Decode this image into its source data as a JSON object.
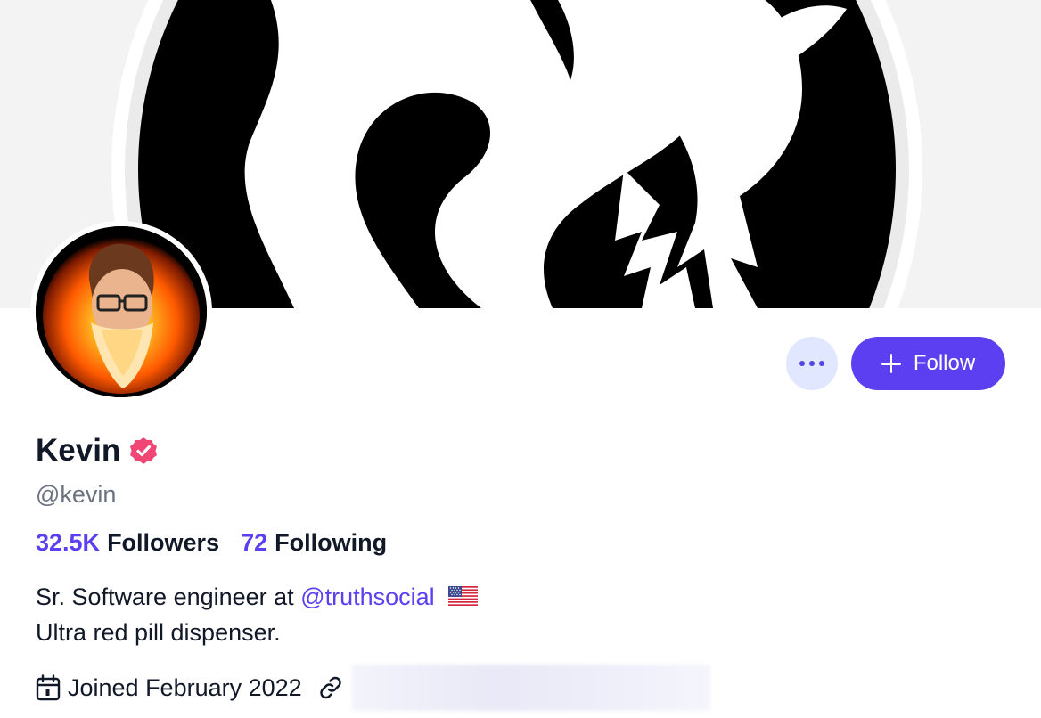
{
  "profile": {
    "display_name": "Kevin",
    "handle": "@kevin",
    "verified": true,
    "verified_color": "#ef4675",
    "accent_color": "#5b3ff0"
  },
  "actions": {
    "more_icon": "ellipsis-icon",
    "follow_label": "Follow",
    "follow_icon": "plus-icon"
  },
  "stats": {
    "followers_count": "32.5K",
    "followers_label": "Followers",
    "following_count": "72",
    "following_label": "Following"
  },
  "bio": {
    "line1_prefix": "Sr. Software engineer at ",
    "line1_mention": "@truthsocial",
    "line1_emoji": "us-flag-icon",
    "line2": "Ultra red pill dispenser."
  },
  "meta": {
    "joined": "Joined February 2022",
    "joined_icon": "calendar-icon",
    "link_icon": "link-icon"
  }
}
